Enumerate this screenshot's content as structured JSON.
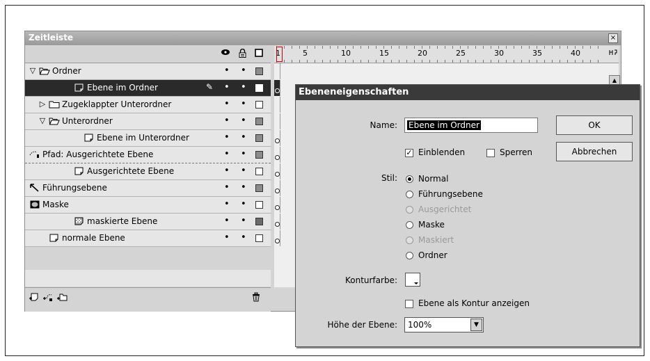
{
  "timeline": {
    "title": "Zeitleiste",
    "close_glyph": "×",
    "header_icons": [
      "eye-icon",
      "lock-icon",
      "outline-icon"
    ],
    "layers": [
      {
        "label": "Ordner",
        "icon": "open-folder-icon",
        "expander": "▽",
        "indent": 0,
        "visible": "•",
        "locked": "•",
        "outline_color": "#8c8c8c",
        "selected": false,
        "dashed": false,
        "keyframe": false
      },
      {
        "label": "Ebene im Ordner",
        "icon": "layer-icon",
        "expander": "",
        "indent": 1,
        "visible": "•",
        "locked": "•",
        "outline_color": "#ffffff",
        "selected": true,
        "dashed": false,
        "keyframe": true
      },
      {
        "label": "Zugeklappter Unterordner",
        "icon": "closed-folder-icon",
        "expander": "▷",
        "indent": 1,
        "visible": "•",
        "locked": "•",
        "outline_color": "#ffffff",
        "selected": false,
        "dashed": false,
        "keyframe": false
      },
      {
        "label": "Unterordner",
        "icon": "open-folder-icon",
        "expander": "▽",
        "indent": 1,
        "visible": "•",
        "locked": "•",
        "outline_color": "#8c8c8c",
        "selected": false,
        "dashed": false,
        "keyframe": false
      },
      {
        "label": "Ebene im Unterordner",
        "icon": "layer-icon",
        "expander": "",
        "indent": 2,
        "visible": "•",
        "locked": "•",
        "outline_color": "#8c8c8c",
        "selected": false,
        "dashed": false,
        "keyframe": true
      },
      {
        "label": "Pfad: Ausgerichtete Ebene",
        "icon": "motion-guide-icon",
        "expander": "",
        "indent": 0,
        "visible": "•",
        "locked": "•",
        "outline_color": "#8c8c8c",
        "selected": false,
        "dashed": true,
        "keyframe": true
      },
      {
        "label": "Ausgerichtete Ebene",
        "icon": "layer-icon",
        "expander": "",
        "indent": 1,
        "visible": "•",
        "locked": "•",
        "outline_color": "#ffffff",
        "selected": false,
        "dashed": false,
        "keyframe": true
      },
      {
        "label": "Führungsebene",
        "icon": "guide-icon",
        "expander": "",
        "indent": 0,
        "visible": "•",
        "locked": "•",
        "outline_color": "#8c8c8c",
        "selected": false,
        "dashed": false,
        "keyframe": true
      },
      {
        "label": "Maske",
        "icon": "mask-icon",
        "expander": "",
        "indent": 0,
        "visible": "•",
        "locked": "•",
        "outline_color": "#ffffff",
        "selected": false,
        "dashed": false,
        "keyframe": true
      },
      {
        "label": "maskierte Ebene",
        "icon": "masked-layer-icon",
        "expander": "",
        "indent": 1,
        "visible": "•",
        "locked": "•",
        "outline_color": "#6a6a6a",
        "selected": false,
        "dashed": false,
        "keyframe": true
      },
      {
        "label": "normale Ebene",
        "icon": "layer-icon",
        "expander": "",
        "indent": 0,
        "visible": "•",
        "locked": "•",
        "outline_color": "#ffffff",
        "selected": false,
        "dashed": false,
        "keyframe": true
      }
    ],
    "ruler_numbers": [
      "1",
      "5",
      "10",
      "15",
      "20",
      "25",
      "30",
      "35",
      "40"
    ],
    "bottom_icons": [
      "insert-layer-icon",
      "add-motion-guide-icon",
      "insert-folder-icon",
      "trash-icon"
    ]
  },
  "dialog": {
    "title": "Ebeneneigenschaften",
    "name_label": "Name:",
    "name_value": "Ebene im Ordner",
    "ok_label": "OK",
    "cancel_label": "Abbrechen",
    "show_label": "Einblenden",
    "show_checked": "✓",
    "lock_label": "Sperren",
    "style_label": "Stil:",
    "styles": [
      {
        "label": "Normal",
        "checked": true,
        "disabled": false
      },
      {
        "label": "Führungsebene",
        "checked": false,
        "disabled": false
      },
      {
        "label": "Ausgerichtet",
        "checked": false,
        "disabled": true
      },
      {
        "label": "Maske",
        "checked": false,
        "disabled": false
      },
      {
        "label": "Maskiert",
        "checked": false,
        "disabled": true
      },
      {
        "label": "Ordner",
        "checked": false,
        "disabled": false
      }
    ],
    "outline_color_label": "Konturfarbe:",
    "outline_mode_label": "Ebene als Kontur anzeigen",
    "height_label": "Höhe der Ebene:",
    "height_value": "100%",
    "dropdown_arrow": "▼"
  }
}
